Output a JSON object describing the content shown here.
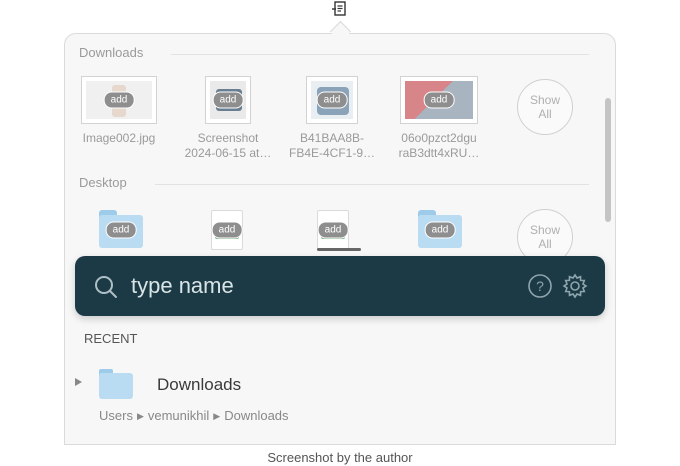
{
  "popover": {
    "tray_icon": "paste-stack-icon",
    "sections": [
      {
        "header": "Downloads",
        "show_all_label_line1": "Show",
        "show_all_label_line2": "All",
        "items": [
          {
            "icon": "image-thumbnail",
            "badge": "add",
            "name_line1": "Image002.jpg",
            "name_line2": ""
          },
          {
            "icon": "image-thumbnail",
            "badge": "add",
            "name_line1": "Screenshot",
            "name_line2": "2024-06-15 at…"
          },
          {
            "icon": "image-thumbnail",
            "badge": "add",
            "name_line1": "B41BAA8B-",
            "name_line2": "FB4E-4CF1-9…"
          },
          {
            "icon": "image-thumbnail",
            "badge": "add",
            "name_line1": "06o0pzct2dgu",
            "name_line2": "raB3dtt4xRU…"
          }
        ]
      },
      {
        "header": "Desktop",
        "show_all_label_line1": "Show",
        "show_all_label_line2": "All",
        "items": [
          {
            "icon": "folder-icon",
            "badge": "add"
          },
          {
            "icon": "document-icon",
            "badge": "add"
          },
          {
            "icon": "document-icon",
            "badge": "add",
            "progress": 1.0
          },
          {
            "icon": "folder-icon",
            "badge": "add"
          }
        ]
      }
    ]
  },
  "search": {
    "placeholder": "type name",
    "icons": [
      "search-icon",
      "help-icon",
      "gear-icon"
    ]
  },
  "recent": {
    "header": "RECENT",
    "items": [
      {
        "name": "Downloads",
        "path": [
          "Users",
          "vemunikhil",
          "Downloads"
        ]
      }
    ]
  },
  "caption": "Screenshot by the author",
  "colors": {
    "search_bar": "#1c3a45",
    "search_text": "#d9e4e7",
    "folder": "#b9dcf3",
    "panel": "#f7f7f7"
  }
}
